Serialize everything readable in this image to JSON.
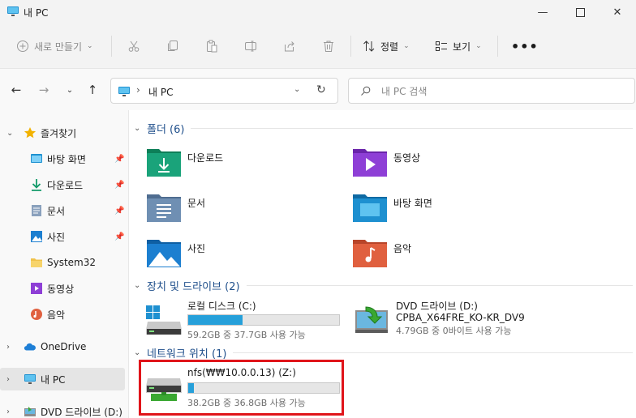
{
  "window": {
    "title": "내 PC"
  },
  "toolbar": {
    "new_label": "새로 만들기",
    "sort_label": "정렬",
    "view_label": "보기"
  },
  "address": {
    "crumb": "내 PC"
  },
  "search": {
    "placeholder": "내 PC 검색"
  },
  "sidebar": {
    "items": [
      {
        "label": "즐겨찾기"
      },
      {
        "label": "바탕 화면"
      },
      {
        "label": "다운로드"
      },
      {
        "label": "문서"
      },
      {
        "label": "사진"
      },
      {
        "label": "System32"
      },
      {
        "label": "동영상"
      },
      {
        "label": "음악"
      },
      {
        "label": "OneDrive"
      },
      {
        "label": "내 PC"
      },
      {
        "label": "DVD 드라이브 (D:)"
      }
    ]
  },
  "groups": {
    "folders": {
      "title": "폴더 (6)"
    },
    "drives": {
      "title": "장치 및 드라이브 (2)"
    },
    "network": {
      "title": "네트워크 위치 (1)"
    }
  },
  "folders": [
    {
      "name": "다운로드",
      "icon": "downloads-folder-icon",
      "color": "#1aa37a"
    },
    {
      "name": "동영상",
      "icon": "videos-folder-icon",
      "color": "#8e3fd6"
    },
    {
      "name": "문서",
      "icon": "documents-folder-icon",
      "color": "#6f8fb3"
    },
    {
      "name": "바탕 화면",
      "icon": "desktop-folder-icon",
      "color": "#1e90d0"
    },
    {
      "name": "사진",
      "icon": "pictures-folder-icon",
      "color": "#1c7fd0"
    },
    {
      "name": "음악",
      "icon": "music-folder-icon",
      "color": "#e0603f"
    }
  ],
  "drives": [
    {
      "name": "로컬 디스크 (C:)",
      "info": "59.2GB 중 37.7GB 사용 가능",
      "used_fraction": 0.36
    },
    {
      "name": "DVD 드라이브 (D:)",
      "label": "CPBA_X64FRE_KO-KR_DV9",
      "info": "4.79GB 중 0바이트 사용 가능"
    }
  ],
  "network": [
    {
      "name": "nfs(₩₩10.0.0.13) (Z:)",
      "info": "38.2GB 중 36.8GB 사용 가능",
      "used_fraction": 0.04
    }
  ],
  "colors": {
    "accent": "#26a0da",
    "group_title": "#1f4f8b",
    "highlight": "#e0141a"
  }
}
